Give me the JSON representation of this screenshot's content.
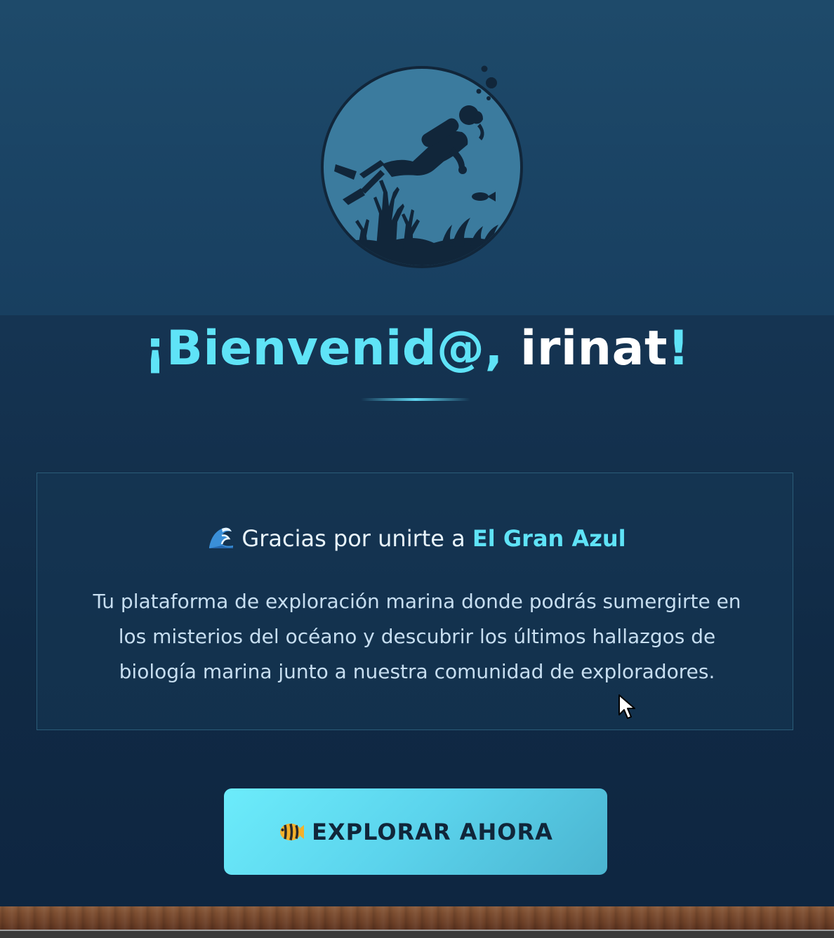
{
  "logo": {
    "icon": "scuba-diver-emblem-icon"
  },
  "welcome": {
    "prefix": "¡Bienvenid@, ",
    "username": "irinat",
    "suffix": "!"
  },
  "card": {
    "heading_icon": "wave-icon",
    "heading_text": "Gracias por unirte a ",
    "brand": "El Gran Azul",
    "body": "Tu plataforma de exploración marina donde podrás sumergirte en los misterios del océano y descubrir los últimos hallazgos de biología marina junto a nuestra comunidad de exploradores."
  },
  "cta": {
    "icon": "tropical-fish-icon",
    "label": "EXPLORAR AHORA"
  },
  "colors": {
    "accent": "#5fe3f7",
    "background": "#153452",
    "button_text": "#10263a"
  }
}
